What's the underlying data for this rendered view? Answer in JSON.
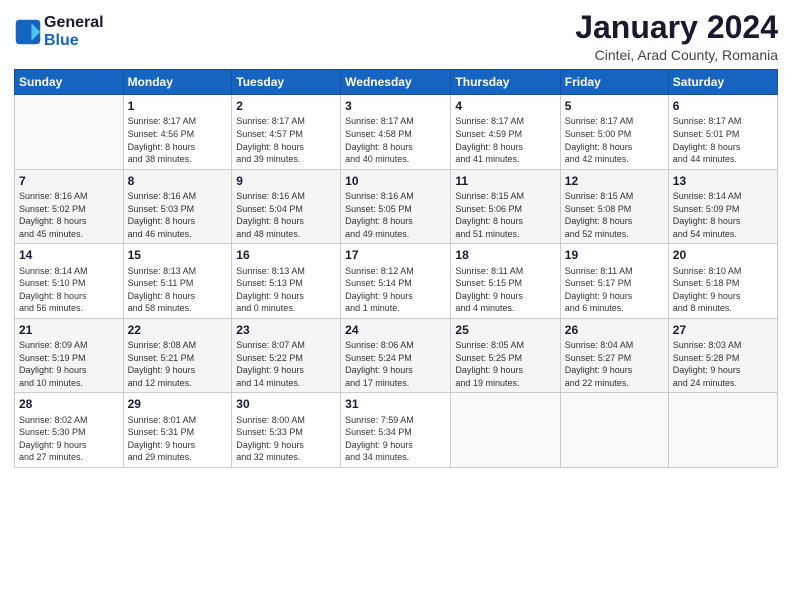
{
  "header": {
    "logo_line1": "General",
    "logo_line2": "Blue",
    "title": "January 2024",
    "subtitle": "Cintei, Arad County, Romania"
  },
  "weekdays": [
    "Sunday",
    "Monday",
    "Tuesday",
    "Wednesday",
    "Thursday",
    "Friday",
    "Saturday"
  ],
  "weeks": [
    [
      {
        "day": "",
        "info": ""
      },
      {
        "day": "1",
        "info": "Sunrise: 8:17 AM\nSunset: 4:56 PM\nDaylight: 8 hours\nand 38 minutes."
      },
      {
        "day": "2",
        "info": "Sunrise: 8:17 AM\nSunset: 4:57 PM\nDaylight: 8 hours\nand 39 minutes."
      },
      {
        "day": "3",
        "info": "Sunrise: 8:17 AM\nSunset: 4:58 PM\nDaylight: 8 hours\nand 40 minutes."
      },
      {
        "day": "4",
        "info": "Sunrise: 8:17 AM\nSunset: 4:59 PM\nDaylight: 8 hours\nand 41 minutes."
      },
      {
        "day": "5",
        "info": "Sunrise: 8:17 AM\nSunset: 5:00 PM\nDaylight: 8 hours\nand 42 minutes."
      },
      {
        "day": "6",
        "info": "Sunrise: 8:17 AM\nSunset: 5:01 PM\nDaylight: 8 hours\nand 44 minutes."
      }
    ],
    [
      {
        "day": "7",
        "info": "Sunrise: 8:16 AM\nSunset: 5:02 PM\nDaylight: 8 hours\nand 45 minutes."
      },
      {
        "day": "8",
        "info": "Sunrise: 8:16 AM\nSunset: 5:03 PM\nDaylight: 8 hours\nand 46 minutes."
      },
      {
        "day": "9",
        "info": "Sunrise: 8:16 AM\nSunset: 5:04 PM\nDaylight: 8 hours\nand 48 minutes."
      },
      {
        "day": "10",
        "info": "Sunrise: 8:16 AM\nSunset: 5:05 PM\nDaylight: 8 hours\nand 49 minutes."
      },
      {
        "day": "11",
        "info": "Sunrise: 8:15 AM\nSunset: 5:06 PM\nDaylight: 8 hours\nand 51 minutes."
      },
      {
        "day": "12",
        "info": "Sunrise: 8:15 AM\nSunset: 5:08 PM\nDaylight: 8 hours\nand 52 minutes."
      },
      {
        "day": "13",
        "info": "Sunrise: 8:14 AM\nSunset: 5:09 PM\nDaylight: 8 hours\nand 54 minutes."
      }
    ],
    [
      {
        "day": "14",
        "info": "Sunrise: 8:14 AM\nSunset: 5:10 PM\nDaylight: 8 hours\nand 56 minutes."
      },
      {
        "day": "15",
        "info": "Sunrise: 8:13 AM\nSunset: 5:11 PM\nDaylight: 8 hours\nand 58 minutes."
      },
      {
        "day": "16",
        "info": "Sunrise: 8:13 AM\nSunset: 5:13 PM\nDaylight: 9 hours\nand 0 minutes."
      },
      {
        "day": "17",
        "info": "Sunrise: 8:12 AM\nSunset: 5:14 PM\nDaylight: 9 hours\nand 1 minute."
      },
      {
        "day": "18",
        "info": "Sunrise: 8:11 AM\nSunset: 5:15 PM\nDaylight: 9 hours\nand 4 minutes."
      },
      {
        "day": "19",
        "info": "Sunrise: 8:11 AM\nSunset: 5:17 PM\nDaylight: 9 hours\nand 6 minutes."
      },
      {
        "day": "20",
        "info": "Sunrise: 8:10 AM\nSunset: 5:18 PM\nDaylight: 9 hours\nand 8 minutes."
      }
    ],
    [
      {
        "day": "21",
        "info": "Sunrise: 8:09 AM\nSunset: 5:19 PM\nDaylight: 9 hours\nand 10 minutes."
      },
      {
        "day": "22",
        "info": "Sunrise: 8:08 AM\nSunset: 5:21 PM\nDaylight: 9 hours\nand 12 minutes."
      },
      {
        "day": "23",
        "info": "Sunrise: 8:07 AM\nSunset: 5:22 PM\nDaylight: 9 hours\nand 14 minutes."
      },
      {
        "day": "24",
        "info": "Sunrise: 8:06 AM\nSunset: 5:24 PM\nDaylight: 9 hours\nand 17 minutes."
      },
      {
        "day": "25",
        "info": "Sunrise: 8:05 AM\nSunset: 5:25 PM\nDaylight: 9 hours\nand 19 minutes."
      },
      {
        "day": "26",
        "info": "Sunrise: 8:04 AM\nSunset: 5:27 PM\nDaylight: 9 hours\nand 22 minutes."
      },
      {
        "day": "27",
        "info": "Sunrise: 8:03 AM\nSunset: 5:28 PM\nDaylight: 9 hours\nand 24 minutes."
      }
    ],
    [
      {
        "day": "28",
        "info": "Sunrise: 8:02 AM\nSunset: 5:30 PM\nDaylight: 9 hours\nand 27 minutes."
      },
      {
        "day": "29",
        "info": "Sunrise: 8:01 AM\nSunset: 5:31 PM\nDaylight: 9 hours\nand 29 minutes."
      },
      {
        "day": "30",
        "info": "Sunrise: 8:00 AM\nSunset: 5:33 PM\nDaylight: 9 hours\nand 32 minutes."
      },
      {
        "day": "31",
        "info": "Sunrise: 7:59 AM\nSunset: 5:34 PM\nDaylight: 9 hours\nand 34 minutes."
      },
      {
        "day": "",
        "info": ""
      },
      {
        "day": "",
        "info": ""
      },
      {
        "day": "",
        "info": ""
      }
    ]
  ]
}
